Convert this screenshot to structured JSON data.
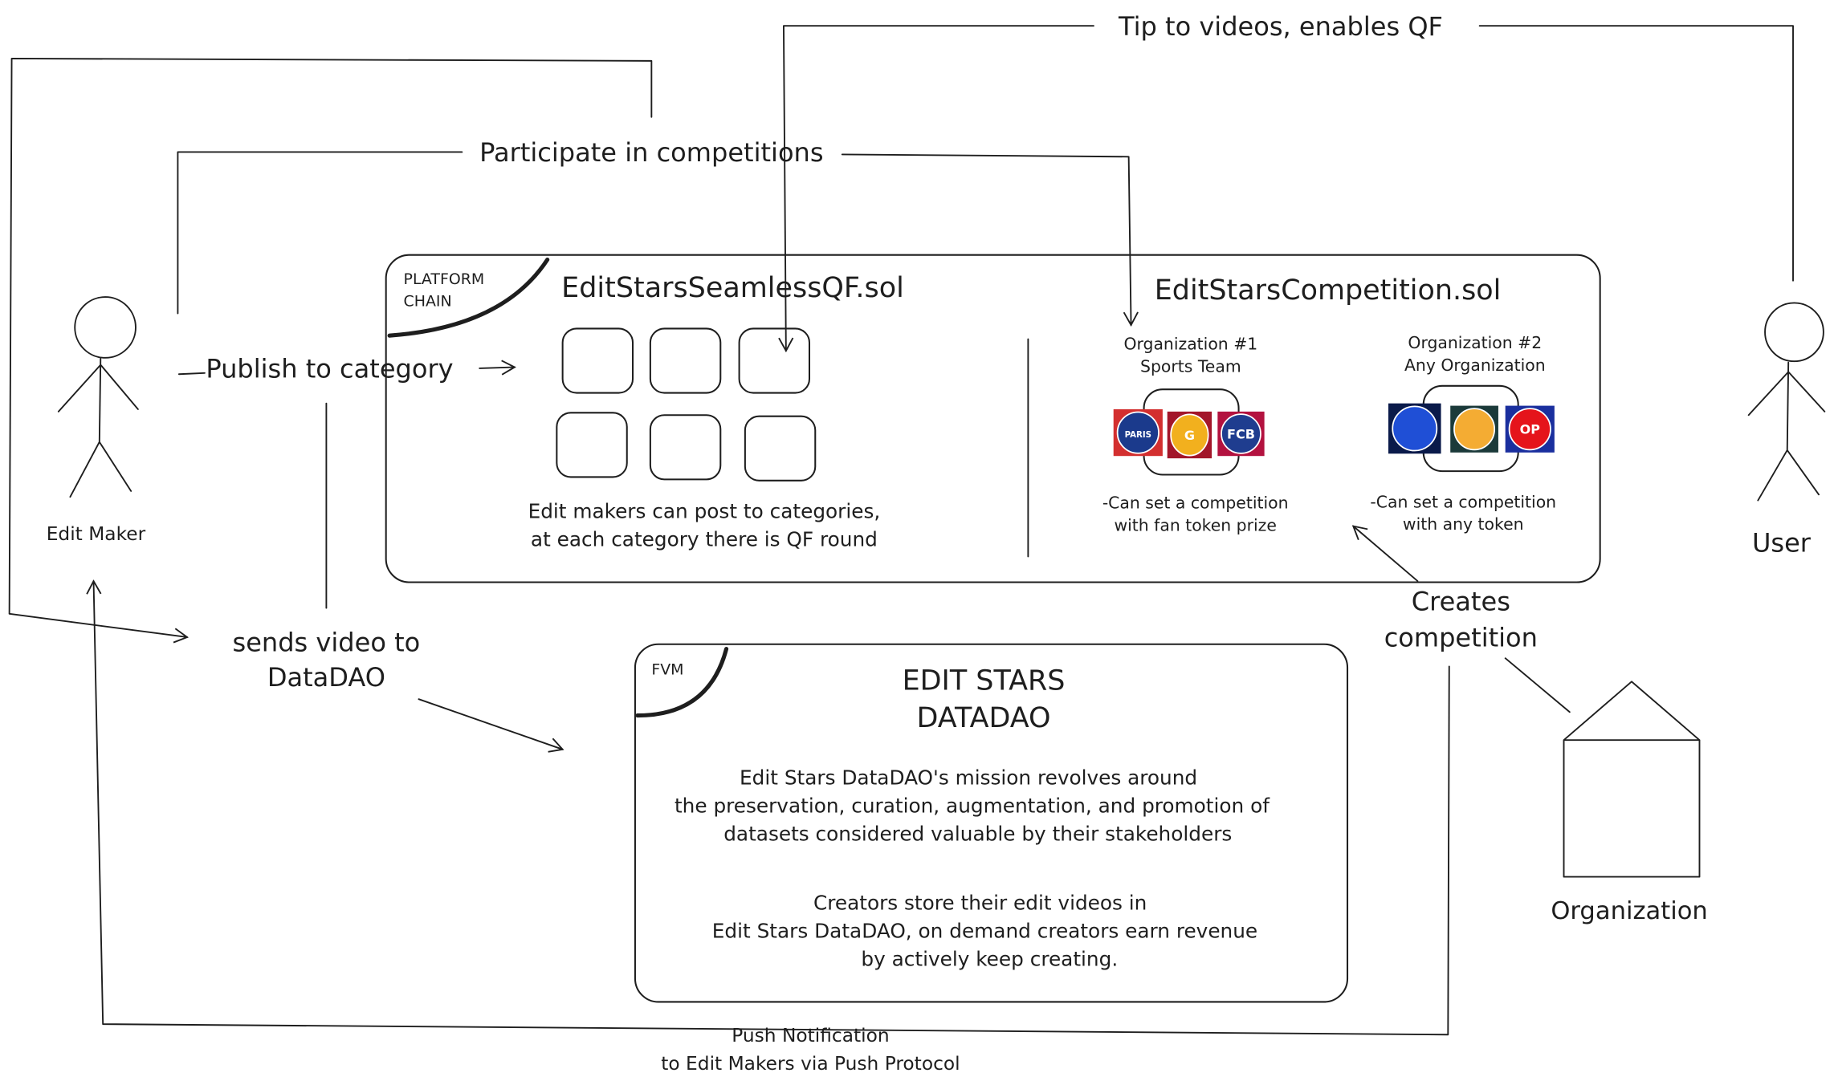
{
  "actors": {
    "edit_maker": "Edit Maker",
    "user": "User",
    "organization": "Organization"
  },
  "platform": {
    "tag_line1": "PLATFORM",
    "tag_line2": "CHAIN",
    "qf_contract": "EditStarsSeamlessQF.sol",
    "qf_caption_line1": "Edit makers can post to categories,",
    "qf_caption_line2": "at each category there is QF round",
    "competition_contract": "EditStarsCompetition.sol",
    "org1": {
      "title_line1": "Organization #1",
      "title_line2": "Sports Team",
      "desc_line1": "-Can set a competition",
      "desc_line2": "with fan token prize",
      "logos": [
        {
          "icon": "psg-fan-token-icon",
          "label": "PARIS",
          "color": "#1b3a8c",
          "accent": "#d32f2f"
        },
        {
          "icon": "galatasaray-fan-token-icon",
          "label": "G",
          "color": "#f2b01e",
          "accent": "#a3162a"
        },
        {
          "icon": "barcelona-fan-token-icon",
          "label": "FCB",
          "color": "#1f3d8f",
          "accent": "#b3123f"
        }
      ]
    },
    "org2": {
      "title_line1": "Organization #2",
      "title_line2": "Any Organization",
      "desc_line1": "-Can set a competition",
      "desc_line2": "with any token",
      "logos": [
        {
          "icon": "ape-token-icon",
          "label": "",
          "color": "#1f4fd6",
          "accent": "#0a1a4a"
        },
        {
          "icon": "dai-token-icon",
          "label": "",
          "color": "#f4ac33",
          "accent": "#1b3a3a"
        },
        {
          "icon": "optimism-token-icon",
          "label": "OP",
          "color": "#e5141b",
          "accent": "#1a2f9e"
        }
      ]
    }
  },
  "fvm": {
    "tag": "FVM",
    "title_line1": "EDIT STARS",
    "title_line2": "DATADAO",
    "mission_lines": [
      "Edit Stars DataDAO's mission revolves around",
      "the preservation, curation, augmentation, and promotion of",
      "datasets considered valuable by their stakeholders"
    ],
    "creators_lines": [
      "Creators store their edit videos in",
      "Edit Stars DataDAO, on demand creators earn revenue",
      "by actively keep creating."
    ]
  },
  "edges": {
    "tip": "Tip to videos, enables QF",
    "participate": "Participate in competitions",
    "publish": "Publish to category",
    "sends_line1": "sends video to",
    "sends_line2": "DataDAO",
    "creates_line1": "Creates",
    "creates_line2": "competition",
    "push_line1": "Push Notification",
    "push_line2": "to Edit Makers via Push Protocol"
  }
}
